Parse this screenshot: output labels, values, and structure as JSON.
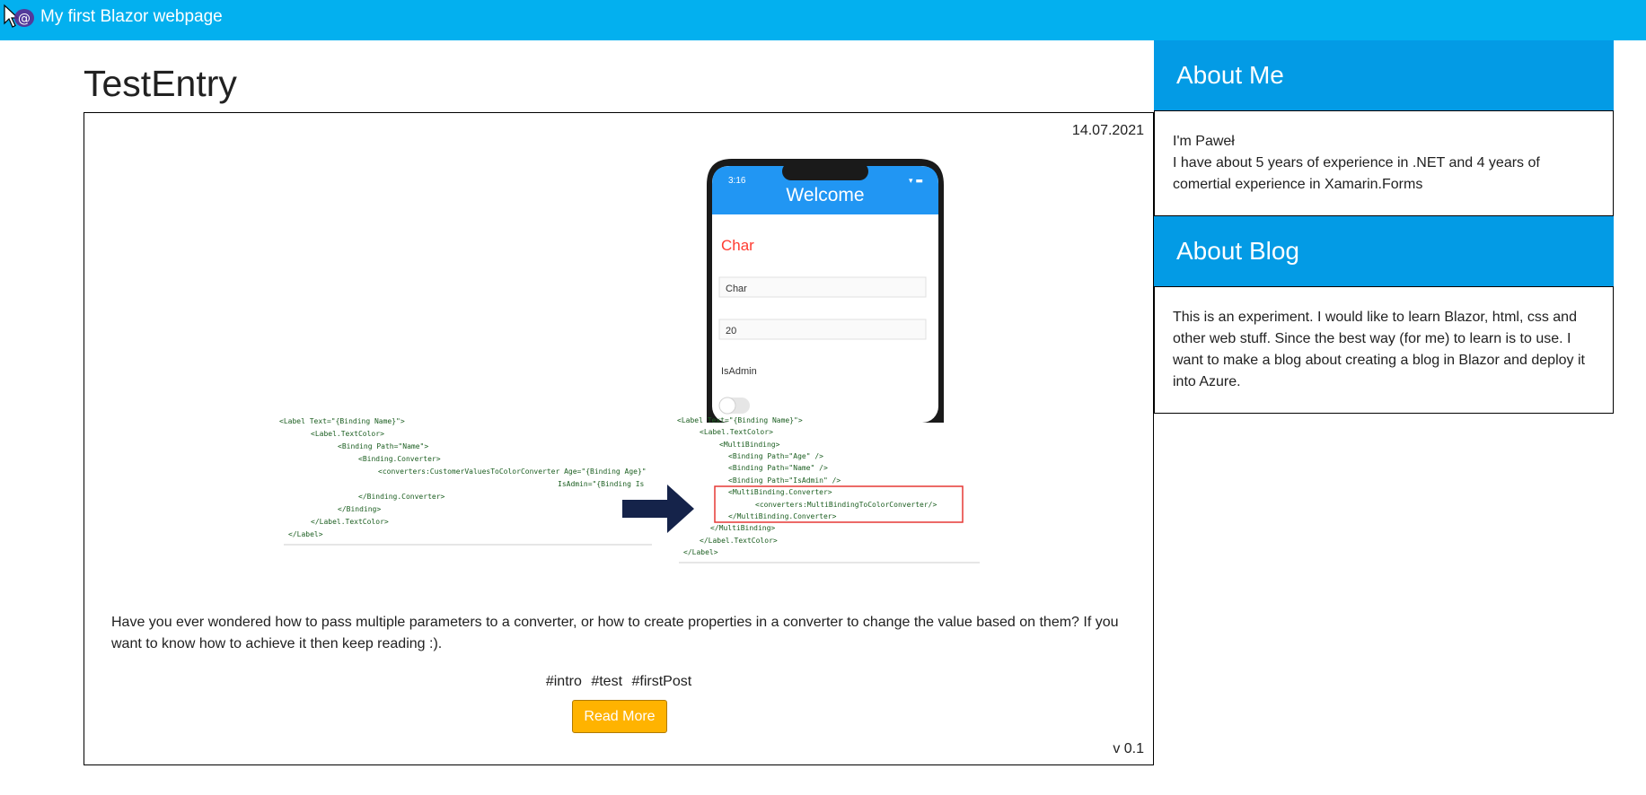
{
  "header": {
    "title": "My first Blazor webpage",
    "logo_icon": "blazor-logo-icon",
    "background": "#03b0ef"
  },
  "post": {
    "title": "TestEntry",
    "date": "14.07.2021",
    "image": {
      "phone": {
        "time": "3:16",
        "welcome": "Welcome",
        "char_heading": "Char",
        "entry_name": "Char",
        "entry_age": "20",
        "isadmin_label": "IsAdmin"
      },
      "code_left": [
        "<Label Text=\"{Binding Name}\">",
        "    <Label.TextColor>",
        "        <Binding Path=\"Name\">",
        "            <Binding.Converter>",
        "                <converters:CustomerValuesToColorConverter Age=\"{Binding Age}\"",
        "                                                        IsAdmin=\"{Binding Is",
        "            </Binding.Converter>",
        "        </Binding>",
        "    </Label.TextColor>",
        "</Label>"
      ],
      "code_right": [
        "<Label Text=\"{Binding Name}\">",
        "    <Label.TextColor>",
        "        <MultiBinding>",
        "            <Binding Path=\"Age\"  />",
        "            <Binding Path=\"Name\" />",
        "            <Binding Path=\"IsAdmin\" />",
        "            <MultiBinding.Converter>",
        "                <converters:MultiBindingToColorConverter/>",
        "            </MultiBinding.Converter>",
        "        </MultiBinding>",
        "    </Label.TextColor>",
        "</Label>"
      ]
    },
    "excerpt": "Have you ever wondered how to pass multiple parameters to a converter, or how to create properties in a converter to change the value based on them? If you want to know how to achieve it then keep reading :).",
    "tags": [
      "#intro",
      "#test",
      "#firstPost"
    ],
    "read_more_label": "Read More",
    "version": "v 0.1"
  },
  "sidebar": {
    "about_me": {
      "title": "About Me",
      "lines": [
        "I'm Paweł",
        "I have about 5 years of experience in .NET and 4 years of comertial experience in Xamarin.Forms"
      ]
    },
    "about_blog": {
      "title": "About Blog",
      "text": "This is an experiment. I would like to learn Blazor, html, css and other web stuff. Since the best way (for me) to learn is to use. I want to make a blog about creating a blog in Blazor and deploy it into Azure."
    }
  },
  "colors": {
    "accent": "#039be5",
    "button": "#ffb300"
  }
}
